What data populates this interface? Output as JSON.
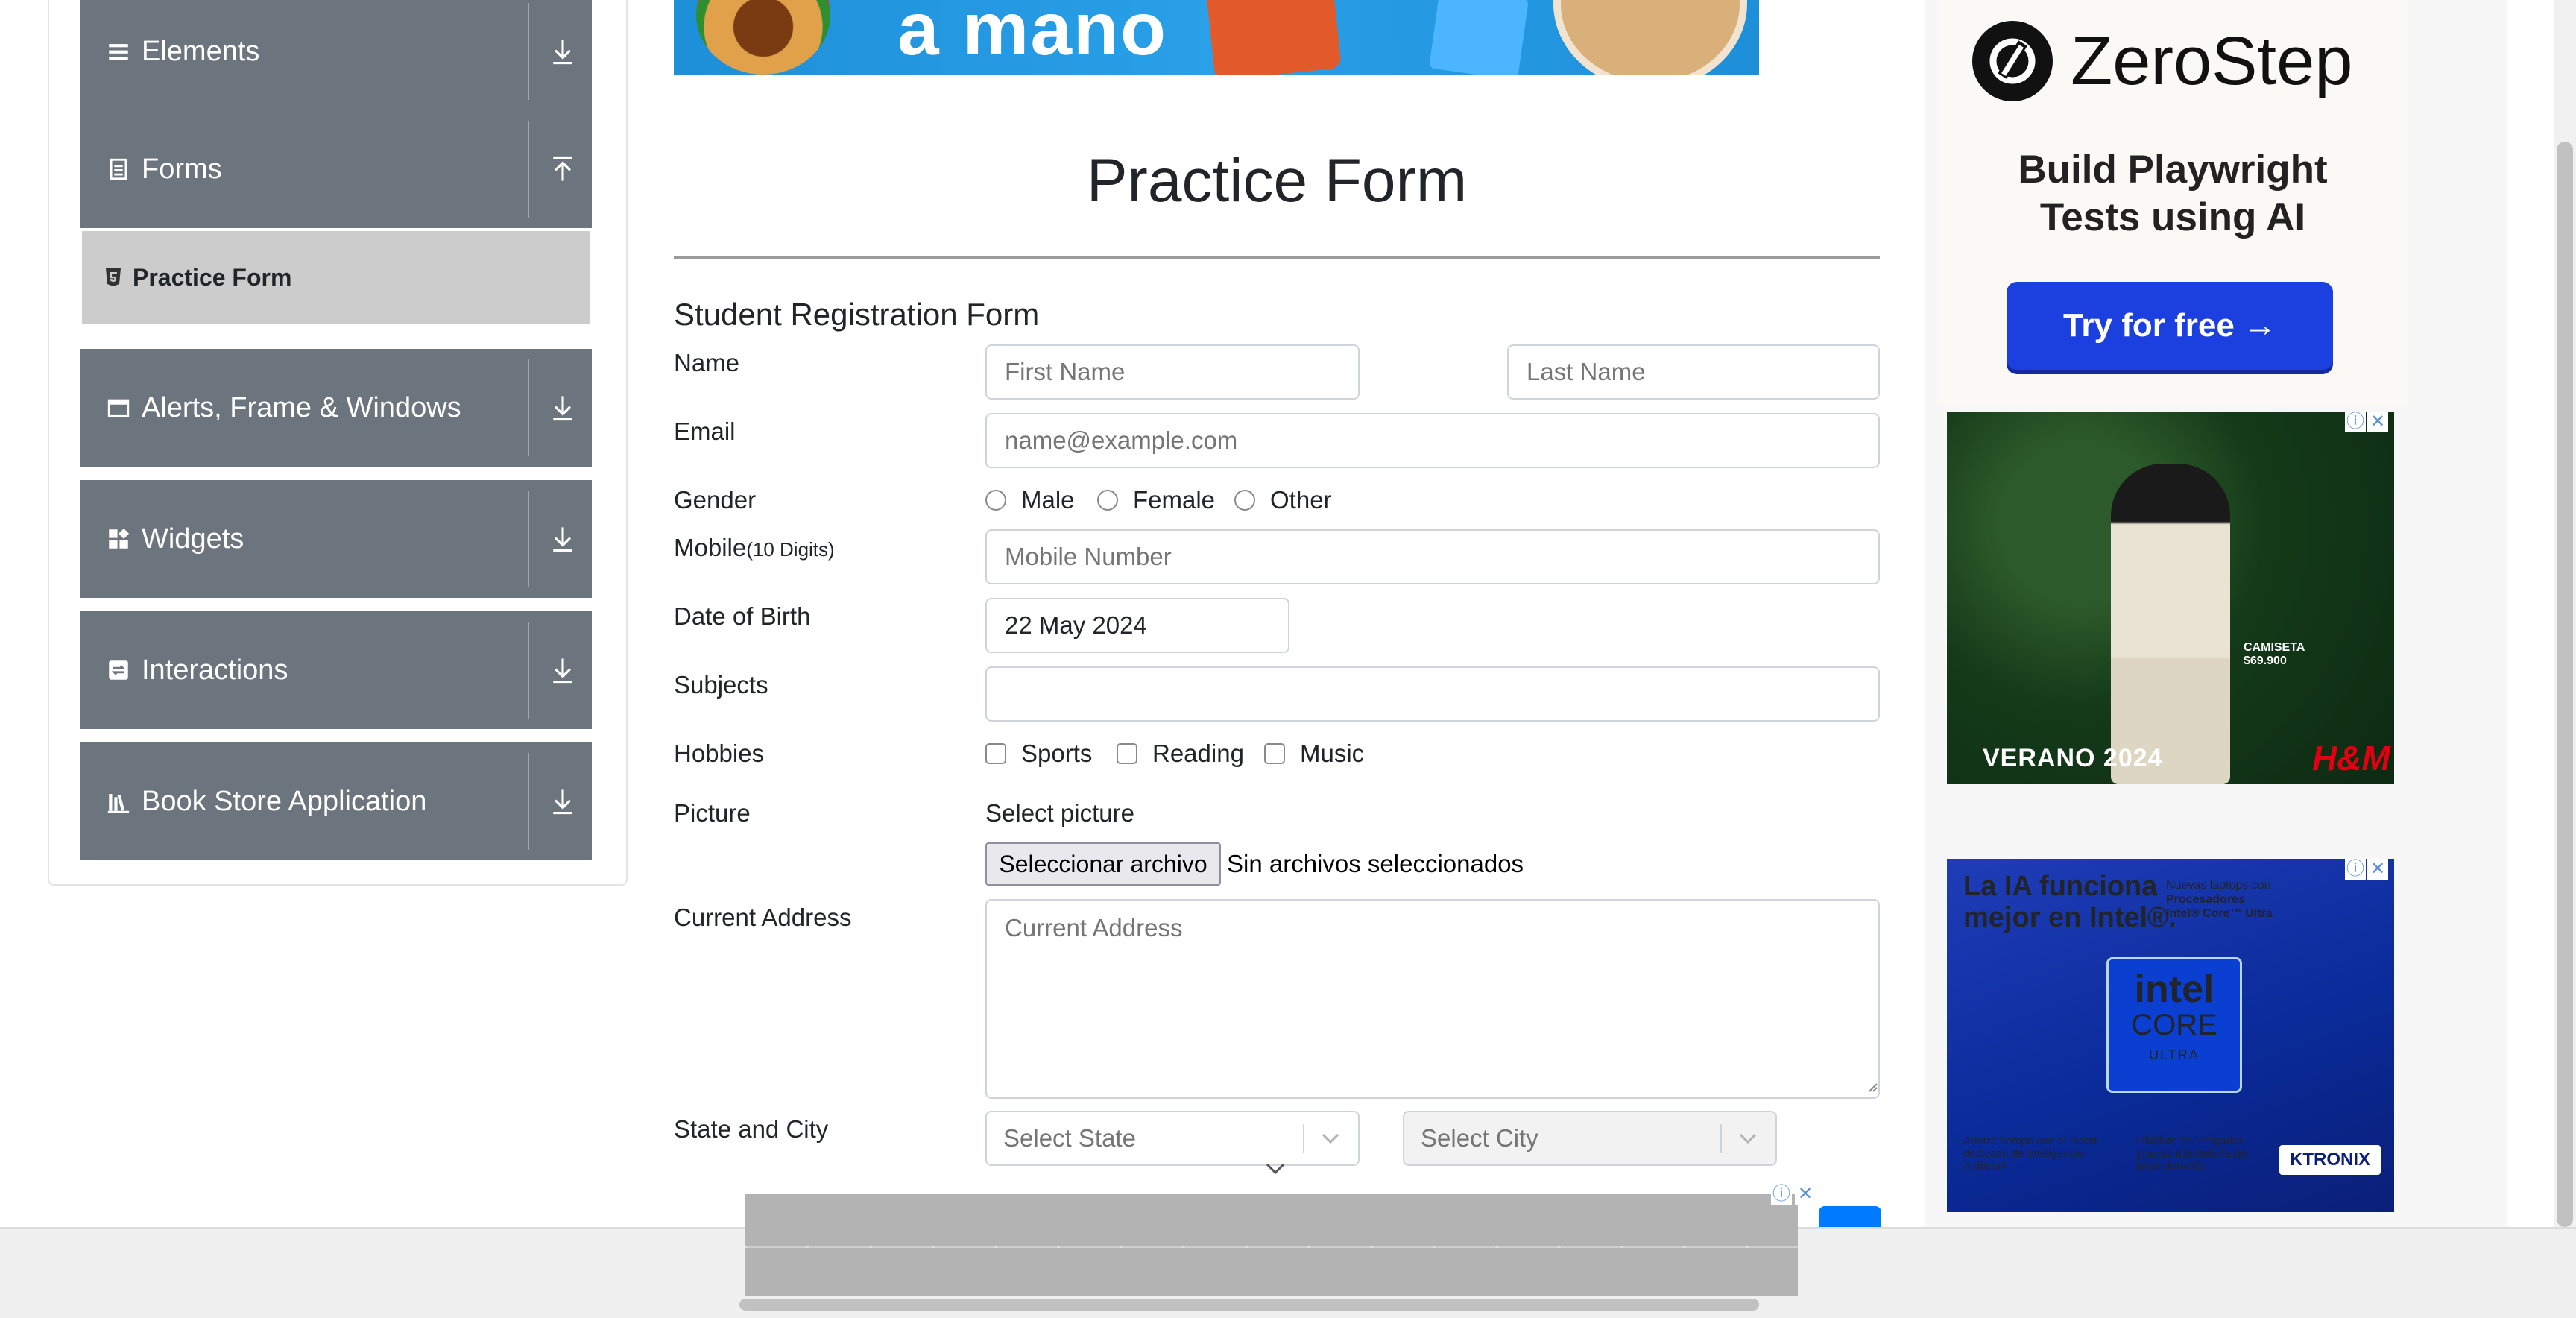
{
  "sidebar": {
    "groups": [
      {
        "label": "Elements",
        "icon": "list-icon",
        "arrow": "download-arrow-icon"
      },
      {
        "label": "Forms",
        "icon": "document-icon",
        "arrow": "upload-arrow-icon"
      },
      {
        "label": "Alerts, Frame & Windows",
        "icon": "window-icon",
        "arrow": "download-arrow-icon"
      },
      {
        "label": "Widgets",
        "icon": "widgets-icon",
        "arrow": "download-arrow-icon"
      },
      {
        "label": "Interactions",
        "icon": "interactions-icon",
        "arrow": "download-arrow-icon"
      },
      {
        "label": "Book Store Application",
        "icon": "books-icon",
        "arrow": "download-arrow-icon"
      }
    ],
    "active_item": {
      "label": "Practice Form",
      "icon": "html5-icon"
    }
  },
  "banner_top": {
    "text": "a mano"
  },
  "page": {
    "title": "Practice Form"
  },
  "form": {
    "title": "Student Registration Form",
    "name": {
      "label": "Name",
      "first_placeholder": "First Name",
      "last_placeholder": "Last Name"
    },
    "email": {
      "label": "Email",
      "placeholder": "name@example.com"
    },
    "gender": {
      "label": "Gender",
      "options": [
        "Male",
        "Female",
        "Other"
      ]
    },
    "mobile": {
      "label": "Mobile",
      "label_hint": "(10 Digits)",
      "placeholder": "Mobile Number"
    },
    "dob": {
      "label": "Date of Birth",
      "value": "22 May 2024"
    },
    "subjects": {
      "label": "Subjects",
      "value": ""
    },
    "hobbies": {
      "label": "Hobbies",
      "options": [
        "Sports",
        "Reading",
        "Music"
      ]
    },
    "picture": {
      "label": "Picture",
      "select_label": "Select picture",
      "button": "Seleccionar archivo",
      "status": "Sin archivos seleccionados"
    },
    "address": {
      "label": "Current Address",
      "placeholder": "Current Address"
    },
    "state_city": {
      "label": "State and City",
      "state_placeholder": "Select State",
      "city_placeholder": "Select City"
    }
  },
  "ads": {
    "zerostep": {
      "brand": "ZeroStep",
      "line1": "Build Playwright",
      "line2": "Tests using AI",
      "button": "Try for free →"
    },
    "hm": {
      "tag1": "CAMISETA",
      "tag2": "$69.900",
      "campaign": "VERANO 2024",
      "brand": "H&M"
    },
    "intel": {
      "headline1": "La IA funciona",
      "headline2": "mejor en Intel®.",
      "small1": "Nuevas laptops con",
      "small2": "Procesadores",
      "small3": "Intel® Core™ Ultra",
      "chip1": "intel",
      "chip2": "CORE",
      "chip3": "ULTRA",
      "foot1": "Ahorra tiempo con el motor dedicado de Inteligencia Artificial²",
      "foot2": "Olvidate del cargador gracias a la batería de larga duración",
      "retailer": "KTRONIX"
    },
    "close_glyph": "✕",
    "info_glyph": "ⓘ"
  },
  "colors": {
    "sidebar_group_bg": "#6c757d",
    "active_item_bg": "#cccccc",
    "input_border": "#ced4da",
    "primary": "#007bff"
  }
}
